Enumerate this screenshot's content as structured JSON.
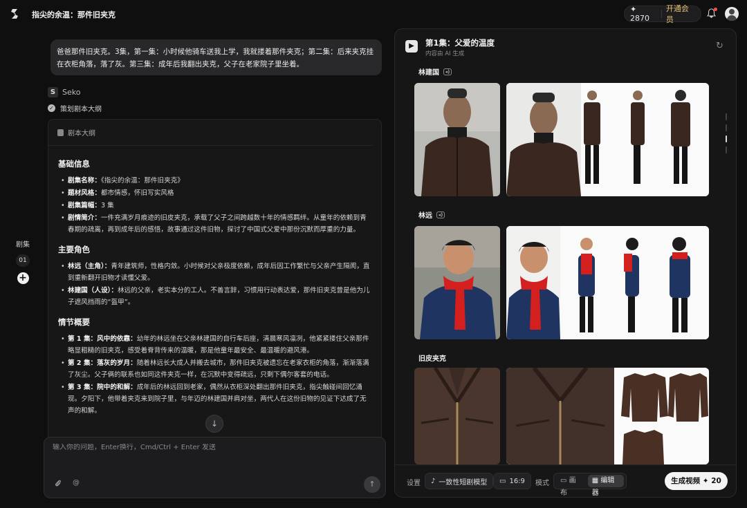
{
  "header": {
    "app_title": "指尖的余温：那件旧夹克",
    "credits": "✦ 2870",
    "vip_label": "开通会员"
  },
  "leftnav": {
    "label": "剧集",
    "episode": "01",
    "add": "+"
  },
  "user_message": "爸爸那件旧夹克。3集，第一集：小时候他骑车送我上学，我就搂着那件夹克；第二集：后来夹克挂在衣柜角落，落了灰。第三集：成年后我翻出夹克，父子在老家院子里坐着。",
  "agent": {
    "name": "Seko",
    "step": "策划剧本大纲"
  },
  "outline": {
    "header": "剧本大纲",
    "basic_title": "基础信息",
    "basic": [
      {
        "k": "剧集名称：",
        "v": "《指尖的余温：那件旧夹克》"
      },
      {
        "k": "题材风格：",
        "v": "都市情感，怀旧写实风格"
      },
      {
        "k": "剧集篇幅：",
        "v": "3 集"
      },
      {
        "k": "剧情简介：",
        "v": "一件充满岁月痕迹的旧皮夹克，承载了父子之间跨越数十年的情感羁绊。从童年的依赖到青春期的疏离，再到成年后的感悟，故事通过这件旧物，探讨了中国式父爱中那份沉默而厚重的力量。"
      }
    ],
    "roles_title": "主要角色",
    "roles": [
      {
        "k": "林远（主角）：",
        "v": "青年建筑师，性格内敛。小时候对父亲极度依赖，成年后因工作繁忙与父亲产生隔阂，直到重新翻开旧物才读懂父爱。"
      },
      {
        "k": "林建国（人设）：",
        "v": "林远的父亲，老实本分的工人。不善言辞，习惯用行动表达爱，那件旧夹克曾是他为儿子遮风挡雨的“盔甲”。"
      }
    ],
    "plot_title": "情节概要",
    "plot": [
      {
        "k": "第 1 集：风中的依靠：",
        "v": "幼年的林远坐在父亲林建国的自行车后座，清晨寒风凛冽，他紧紧搂住父亲那件略显粗糙的旧夹克，感受着脊背传来的温暖，那是他童年最安全、最温暖的避风港。"
      },
      {
        "k": "第 2 集：落灰的岁月：",
        "v": "随着林远长大成人并搬去城市，那件旧夹克被遗忘在老家衣柜的角落，渐渐落满了灰尘。父子俩的联系也如同这件夹克一样，在沉默中变得疏远，只剩下偶尔客套的电话。"
      },
      {
        "k": "第 3 集：院中的和解：",
        "v": "成年后的林远回到老家，偶然从衣柜深处翻出那件旧夹克，指尖触碰间回忆涌现。夕阳下，他带着夹克来到院子里，与年迈的林建国并肩对坐，两代人在这份旧物的见证下达成了无声的和解。"
      }
    ]
  },
  "composer": {
    "placeholder": "输入你的问题，Enter换行，Cmd/Ctrl + Enter 发送"
  },
  "panel": {
    "title": "第1集：父爱的温度",
    "subtitle": "内容由 AI 生成",
    "assets": [
      {
        "name": "林建国"
      },
      {
        "name": "林远"
      },
      {
        "name": "旧皮夹克"
      }
    ]
  },
  "footer": {
    "settings_label": "设置",
    "model": "一致性短剧模型",
    "ratio": "16:9",
    "mode_label": "模式",
    "mode_canvas": "画布",
    "mode_editor": "编辑器",
    "generate": "生成视频 ✦ 20"
  }
}
